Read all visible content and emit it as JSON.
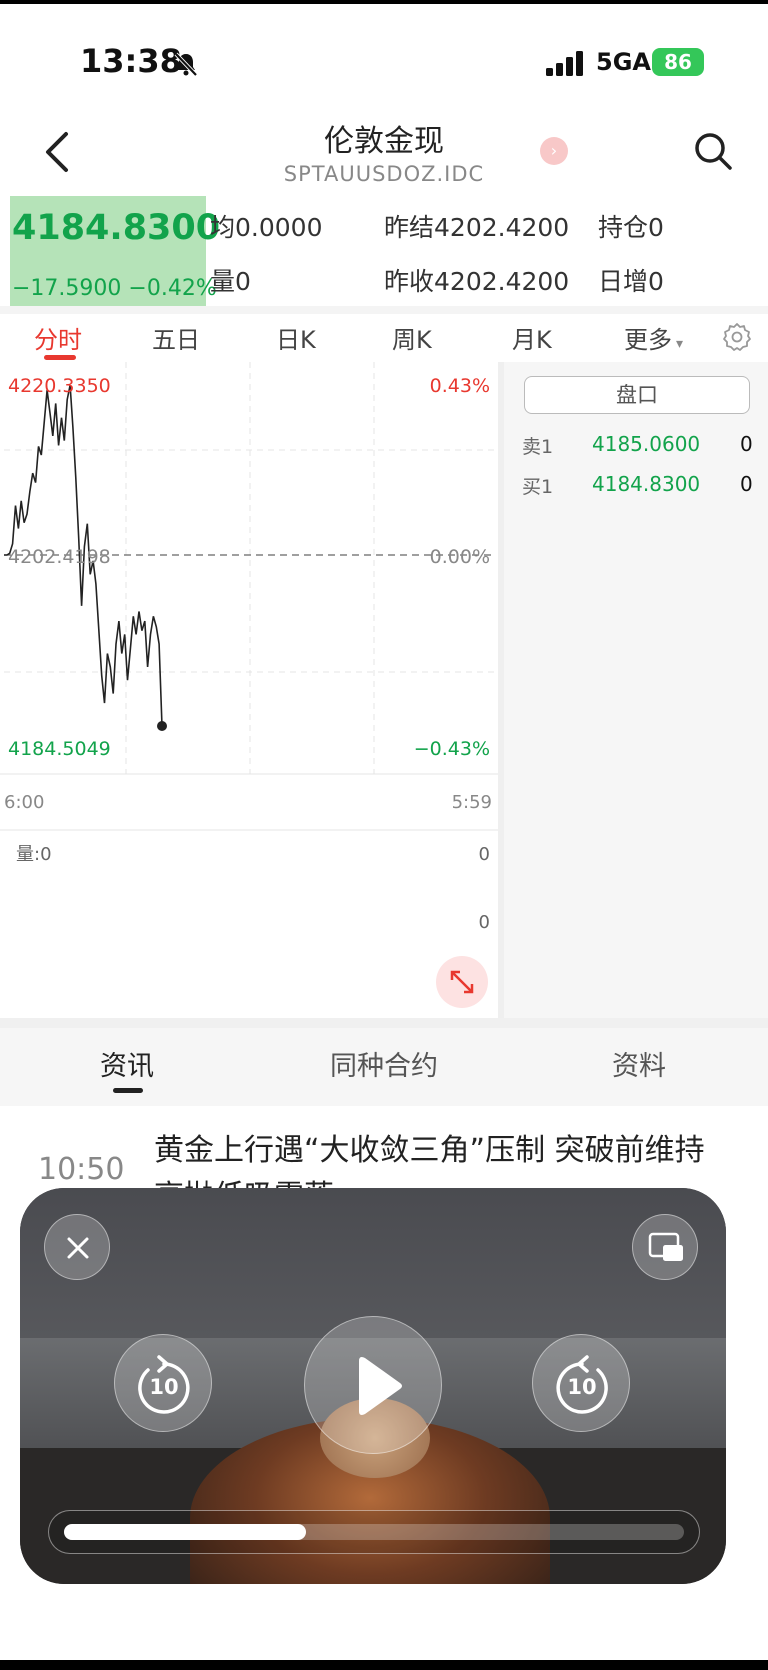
{
  "status_bar": {
    "time": "13:38",
    "network": "5GA",
    "battery": "86"
  },
  "header": {
    "title": "伦敦金现",
    "code": "SPTAUUSDOZ.IDC"
  },
  "quote": {
    "price": "4184.8300",
    "change": "−17.5900 −0.42%",
    "avg_label": "均",
    "avg_value": "0.0000",
    "prev_settle_label": "昨结",
    "prev_settle_value": "4202.4200",
    "open_interest_label": "持仓",
    "open_interest_value": "0",
    "volume_label": "量",
    "volume_value": "0",
    "prev_close_label": "昨收",
    "prev_close_value": "4202.4200",
    "daily_increase_label": "日增",
    "daily_increase_value": "0"
  },
  "tabs": [
    "分时",
    "五日",
    "日K",
    "周K",
    "月K",
    "更多"
  ],
  "chart_data": {
    "type": "line",
    "title": "",
    "x_start": "6:00",
    "x_end": "5:59",
    "y_max": 4220.335,
    "y_max_label": "4220.3350",
    "y_mid_label": "4202.4198",
    "y_min": 4184.5049,
    "y_min_label": "4184.5049",
    "pct_max": "0.43%",
    "pct_mid": "0.00%",
    "pct_min": "−0.43%",
    "reference_value": 4202.4198,
    "series": [
      {
        "values": [
          4202.42,
          4202.42,
          4202.6,
          4203.6,
          4207.6,
          4205.2,
          4208.1,
          4205.8,
          4206.7,
          4209.1,
          4211.0,
          4210.0,
          4213.8,
          4212.9,
          4216.3,
          4219.7,
          4217.3,
          4214.9,
          4218.3,
          4213.9,
          4216.8,
          4214.4,
          4218.7,
          4220.2,
          4215.8,
          4210.5,
          4204.2,
          4197.1,
          4203.3,
          4205.7,
          4200.4,
          4201.8,
          4199.4,
          4194.6,
          4189.8,
          4186.9,
          4192.1,
          4190.7,
          4187.9,
          4193.1,
          4195.5,
          4192.1,
          4194.1,
          4189.3,
          4192.6,
          4196.0,
          4194.1,
          4196.5,
          4194.5,
          4195.5,
          4190.7,
          4194.1,
          4196.0,
          4194.9,
          4193.1,
          4184.5
        ]
      }
    ],
    "volume_label": "量:0",
    "volume_top": "0",
    "volume_bottom": "0"
  },
  "order_book": {
    "button": "盘口",
    "sell": {
      "label": "卖1",
      "price": "4185.0600",
      "qty": "0"
    },
    "buy": {
      "label": "买1",
      "price": "4184.8300",
      "qty": "0"
    }
  },
  "news_tabs": [
    "资讯",
    "同种合约",
    "资料"
  ],
  "news": [
    {
      "time": "10:50",
      "title": "黄金上行遇“大收敛三角”压制 突破前维持高抛低吸需落"
    }
  ],
  "video": {
    "skip_back": "10",
    "skip_forward": "10",
    "progress": 0.39
  },
  "colors": {
    "up": "#e8382f",
    "down": "#12a34b",
    "price_bg": "#b5e3b8"
  }
}
